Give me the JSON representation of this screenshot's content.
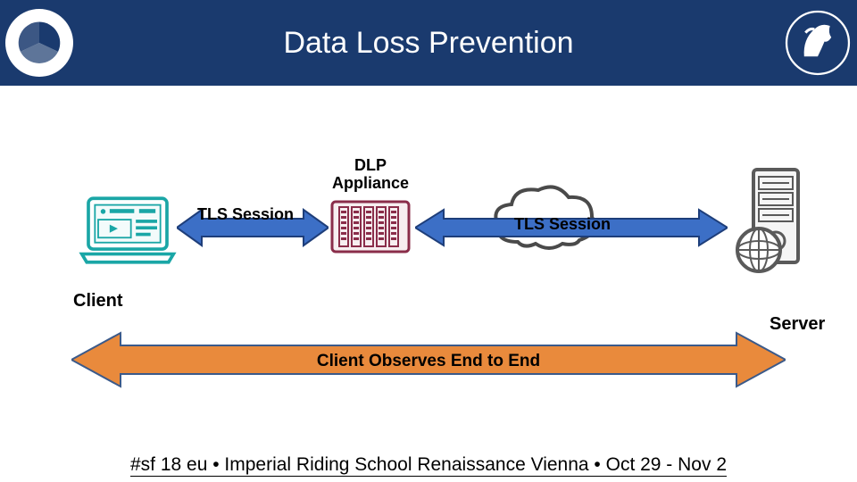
{
  "header": {
    "title": "Data Loss Prevention"
  },
  "diagram": {
    "dlp_label": "DLP Appliance",
    "tls_session_1": "TLS Session",
    "tls_session_2": "TLS Session",
    "client_label": "Client",
    "server_label": "Server",
    "observe_label": "Client Observes End to End"
  },
  "footer": {
    "text": "#sf 18 eu  •  Imperial Riding School Renaissance Vienna  •  Oct 29 - Nov 2"
  },
  "colors": {
    "header_bg": "#1a3a6e",
    "arrow_blue_fill": "#3c6fc6",
    "arrow_blue_stroke": "#1e3e7a",
    "arrow_orange_fill": "#e98a3c",
    "arrow_orange_stroke": "#3b5a8a",
    "client_stroke": "#1aa6a6",
    "appliance_stroke": "#8a2d4a",
    "server_stroke": "#5a5a5a"
  }
}
